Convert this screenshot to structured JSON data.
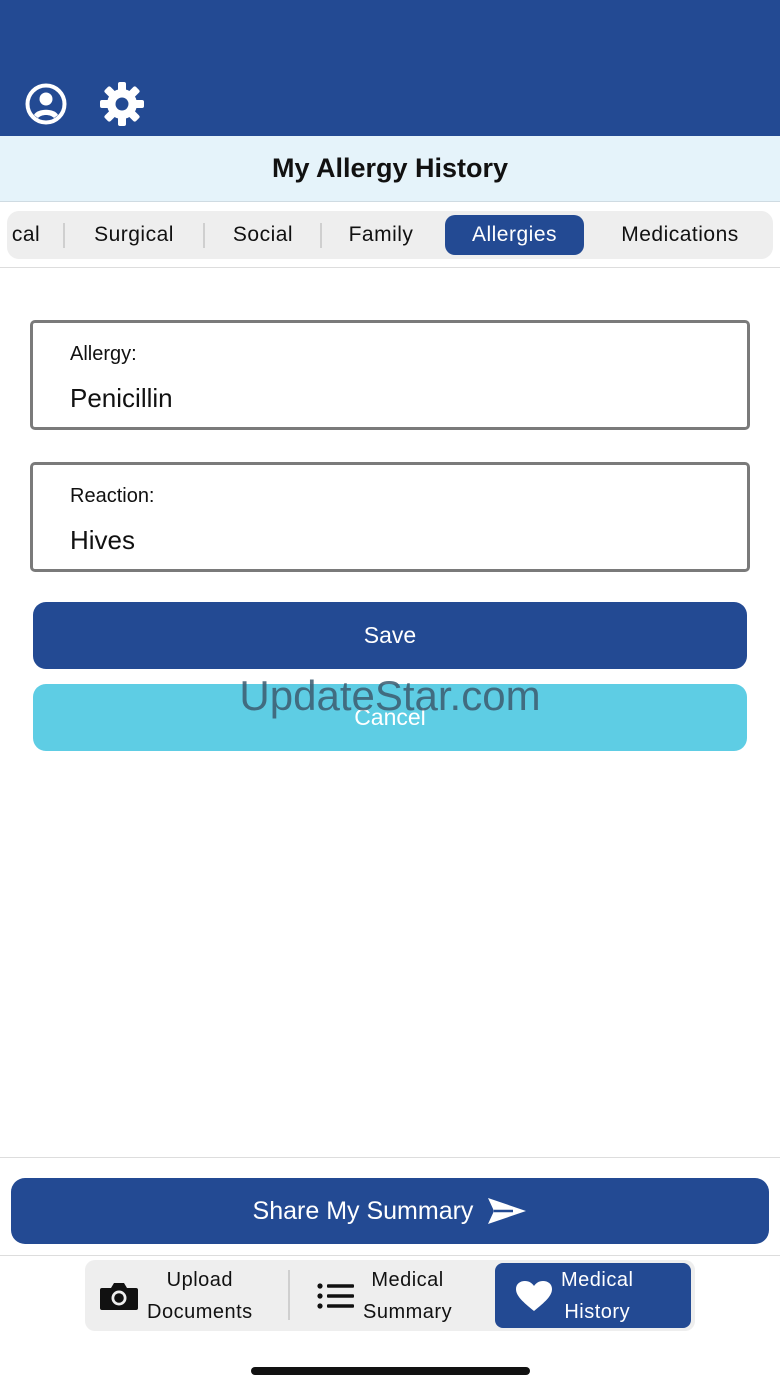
{
  "icons": {
    "profile": "user-circle-icon",
    "settings": "gear-icon",
    "share": "paper-plane-icon",
    "camera": "camera-icon",
    "list": "list-icon",
    "heart": "heart-icon"
  },
  "colors": {
    "primary": "#234a93",
    "title_bg": "#e5f3fa",
    "cancel": "#5ecde4",
    "tab_bg": "#eeeeee"
  },
  "header": {
    "title": "My Allergy History"
  },
  "tabs": [
    {
      "label": "cal",
      "active": false
    },
    {
      "label": "Surgical",
      "active": false
    },
    {
      "label": "Social",
      "active": false
    },
    {
      "label": "Family",
      "active": false
    },
    {
      "label": "Allergies",
      "active": true
    },
    {
      "label": "Medications",
      "active": false
    }
  ],
  "form": {
    "allergy_label": "Allergy:",
    "allergy_value": "Penicillin",
    "reaction_label": "Reaction:",
    "reaction_value": "Hives",
    "save_label": "Save",
    "cancel_label": "Cancel"
  },
  "watermark": "UpdateStar.com",
  "share": {
    "label": "Share My Summary"
  },
  "bottom_nav": [
    {
      "line1": "Upload",
      "line2": "Documents",
      "active": false
    },
    {
      "line1": "Medical",
      "line2": "Summary",
      "active": false
    },
    {
      "line1": "Medical",
      "line2": "History",
      "active": true
    }
  ]
}
